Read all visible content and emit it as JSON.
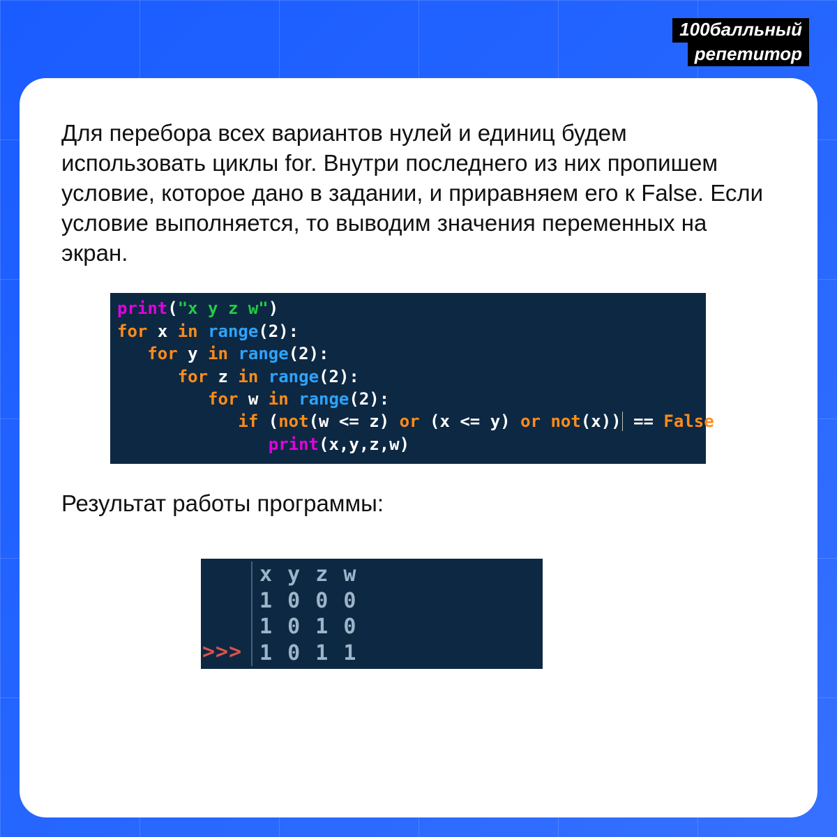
{
  "brand": {
    "line1": "100балльный",
    "line2": "репетитор"
  },
  "paragraph": "Для перебора всех вариантов нулей и единиц будем использовать циклы for. Внутри последнего из них пропишем условие, которое дано в задании, и приравняем его к False. Если условие выполняется, то выводим значения переменных на экран.",
  "code": {
    "l1_print": "print",
    "l1_str": "\"x y z w\"",
    "kw_for": "for",
    "kw_in": "in",
    "kw_if": "if",
    "kw_or": "or",
    "kw_not": "not",
    "fn_range": "range",
    "val_false": "False",
    "var_x": "x",
    "var_y": "y",
    "var_z": "z",
    "var_w": "w",
    "num_2": "2",
    "eqeq": "==",
    "lte": "<=",
    "print_args": "(x,y,z,w)"
  },
  "result_label": "Результат работы программы:",
  "output": {
    "prompt": ">>>",
    "lines": [
      "x y z w",
      "1 0 0 0",
      "1 0 1 0",
      "1 0 1 1"
    ]
  }
}
